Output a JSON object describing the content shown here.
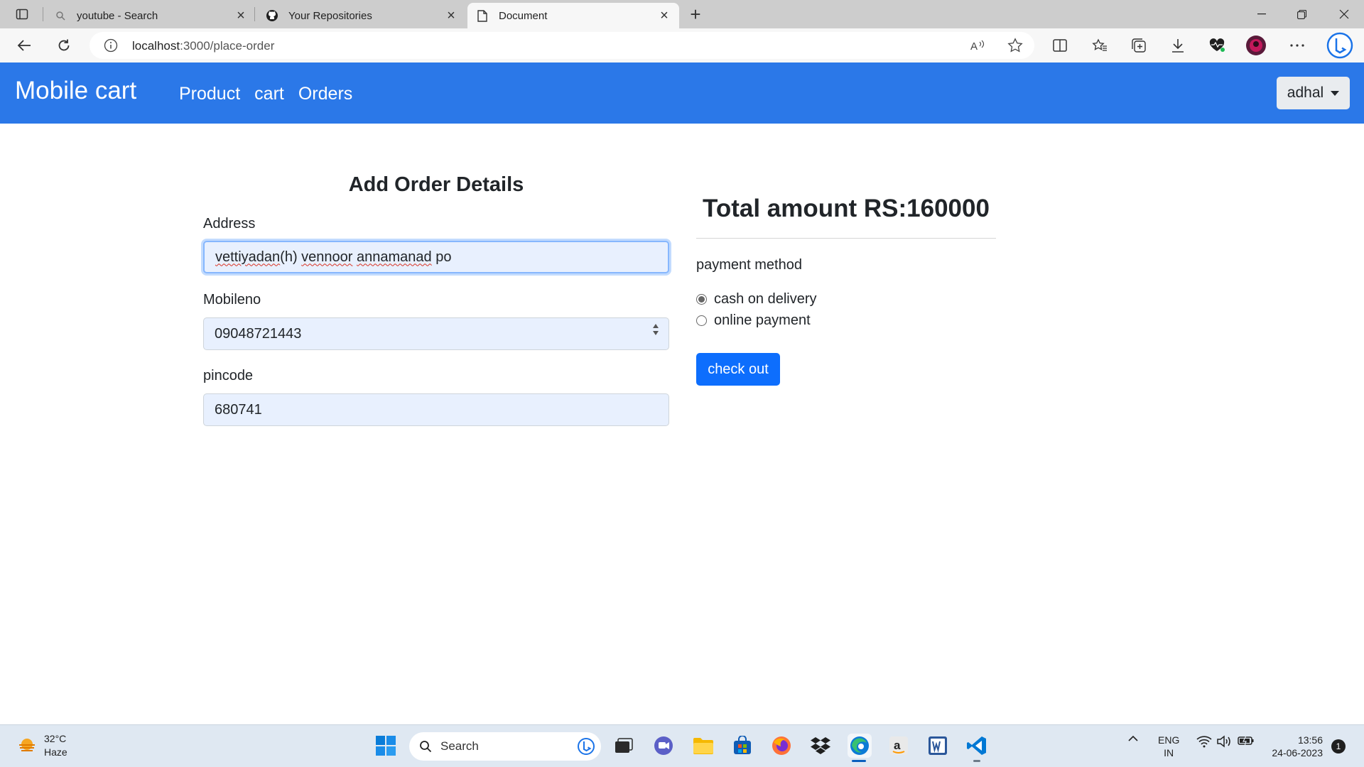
{
  "browser": {
    "tabs": [
      {
        "title": "youtube - Search",
        "active": false
      },
      {
        "title": "Your Repositories",
        "active": false
      },
      {
        "title": "Document",
        "active": true
      }
    ],
    "url_host": "localhost",
    "url_path": ":3000/place-order"
  },
  "navbar": {
    "brand": "Mobile cart",
    "links": [
      "Product",
      "cart",
      "Orders"
    ],
    "user": "adhal",
    "color": "#2b78e8"
  },
  "form": {
    "heading": "Add Order Details",
    "address": {
      "label": "Address",
      "value_words": [
        "vettiyadan",
        "(h) ",
        "vennoor",
        " ",
        "annamanad",
        " po"
      ]
    },
    "mobile": {
      "label": "Mobileno",
      "value": "09048721443"
    },
    "pincode": {
      "label": "pincode",
      "value": "680741"
    }
  },
  "summary": {
    "total": "Total amount RS:160000",
    "payment_label": "payment method",
    "options": [
      {
        "label": "cash on delivery",
        "checked": true
      },
      {
        "label": "online payment",
        "checked": false
      }
    ],
    "checkout": "check out",
    "button_color": "#0d6efd"
  },
  "taskbar": {
    "temp": "32°C",
    "weather": "Haze",
    "search": "Search",
    "lang_top": "ENG",
    "lang_bottom": "IN",
    "time": "13:56",
    "date": "24-06-2023",
    "notifications": "1"
  }
}
